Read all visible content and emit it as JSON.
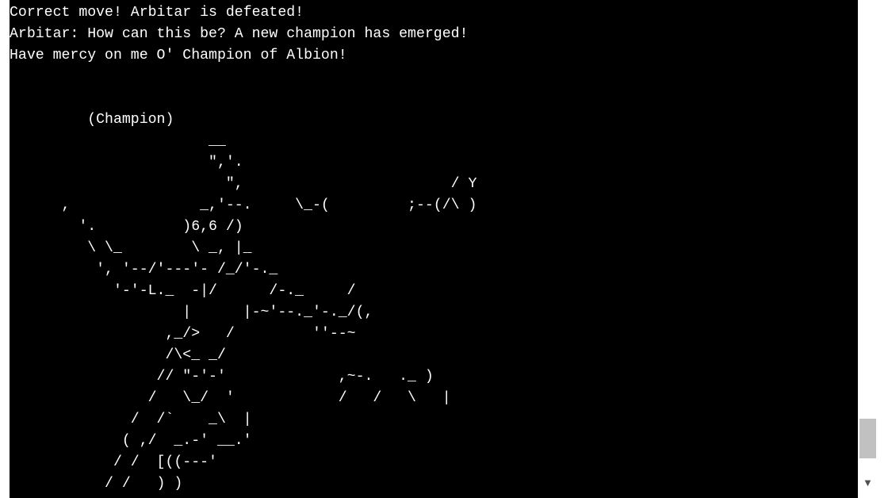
{
  "terminal": {
    "lines": [
      "Correct move! Arbitar is defeated!",
      "Arbitar: How can this be? A new champion has emerged!",
      "Have mercy on me O' Champion of Albion!",
      "",
      "",
      "         (Champion)",
      "                       __",
      "                       \",'.",
      "                         \",                        / Y",
      "      ,               _,'--.     \\_-(         ;--(/\\ )",
      "        '.          )6,6 /)",
      "         \\ \\_        \\ _, |_",
      "          ', '--/'---'- /_/'-._",
      "            '-'-L._  -|/      /-._     /",
      "                    |      |-~'--._'-._/(,",
      "                  ,_/>   /         ''--~",
      "                  /\\<_ _/",
      "                 // \"-'-'             ,~-.   ._ )",
      "                /   \\_/  '            /   /   \\   |",
      "              /  /`    _\\  |",
      "             ( ,/  _.-' __.'",
      "            / /  [((---'",
      "           / /   ) )"
    ]
  },
  "scrollbar": {
    "down_arrow_icon": "triangle-down"
  }
}
